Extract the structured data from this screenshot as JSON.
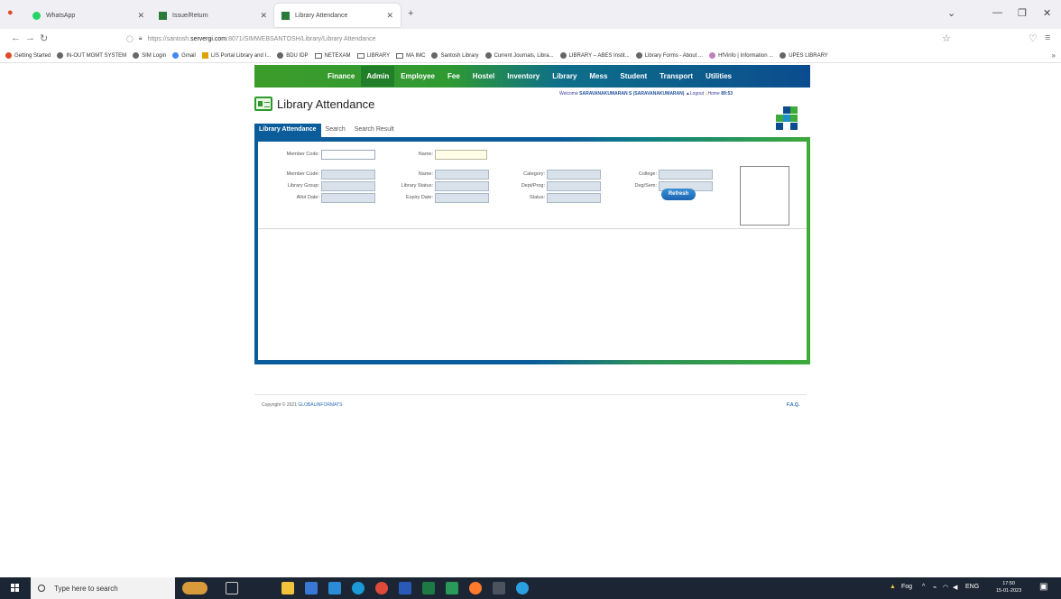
{
  "browser": {
    "tabs": [
      {
        "label": "WhatsApp",
        "icon": "whatsapp-icon"
      },
      {
        "label": "Issue/Return",
        "icon": "app-icon"
      },
      {
        "label": "Library Attendance",
        "icon": "app-icon",
        "active": true
      }
    ],
    "url_prefix": "https://santosh.",
    "url_host": "servergi.com",
    "url_path": ":8071/SIMWEBSANTOSH/Library/Library Attendance",
    "bookmarks": [
      "Getting Started",
      "IN-OUT MGMT SYSTEM",
      "SIM Login",
      "Gmail",
      "LIS Portal Library and I...",
      "BDU IDP",
      "NETEXAM",
      "LIBRARY",
      "MA IMC",
      "Santosh Library",
      "Current Journals, Libra...",
      "LIBRARY – ABES Instit...",
      "Library Forms - About ...",
      "HfVinfo | Information ...",
      "UPES LIBRARY"
    ]
  },
  "app": {
    "menu": [
      "Finance",
      "Admin",
      "Employee",
      "Fee",
      "Hostel",
      "Inventory",
      "Library",
      "Mess",
      "Student",
      "Transport",
      "Utilities"
    ],
    "welcome_prefix": "Welcome",
    "welcome_name": "SARAVANAKUMARAN S (SARAVANAKUMARAN)",
    "logout": "Logout",
    "home": "Home",
    "counter": "89:53",
    "page_title": "Library Attendance",
    "tabs": [
      "Library Attendance",
      "Search",
      "Search Result"
    ],
    "form": {
      "member_code_label": "Member Code:",
      "name_label": "Name:",
      "member_code_label2": "Member Code:",
      "name_label2": "Name:",
      "category_label": "Category:",
      "college_label": "College:",
      "library_group_label": "Library Group:",
      "library_status_label": "Library Status:",
      "dept_prog_label": "Dept/Prog:",
      "deg_sem_label": "Deg/Sem:",
      "allot_date_label": "Allot Date:",
      "expiry_date_label": "Expiry Date:",
      "status_label": "Status:",
      "refresh_label": "Refresh"
    },
    "footer_copyright": "Copyright © 2021",
    "footer_brand": "GLOBALINFORMATS",
    "footer_faq": "F.A.Q."
  },
  "taskbar": {
    "search_placeholder": "Type here to search",
    "weather": "Fog",
    "lang": "ENG",
    "time": "17:50",
    "date": "15-01-2023"
  }
}
